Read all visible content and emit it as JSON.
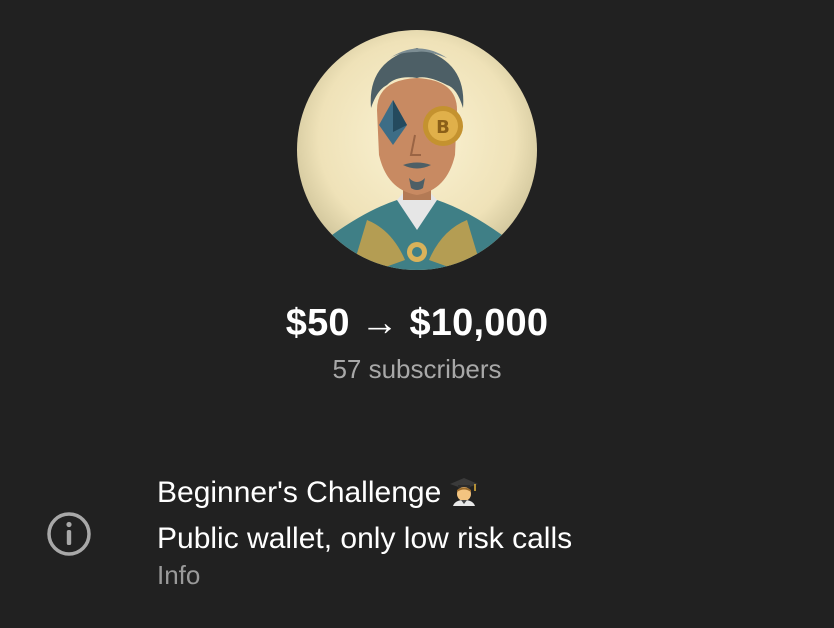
{
  "channel": {
    "title": "$50 → $10,000",
    "subscribers": "57 subscribers",
    "avatar_icon": "avatar-crypto-man-icon"
  },
  "info": {
    "line1": "Beginner's Challenge",
    "line1_emoji": "student-emoji-icon",
    "line2": "Public wallet, only low risk calls",
    "label": "Info",
    "icon": "info-icon"
  },
  "colors": {
    "background": "#212121",
    "primary_text": "#ffffff",
    "secondary_text": "#a8a8a8",
    "icon": "#a8a8a8"
  }
}
